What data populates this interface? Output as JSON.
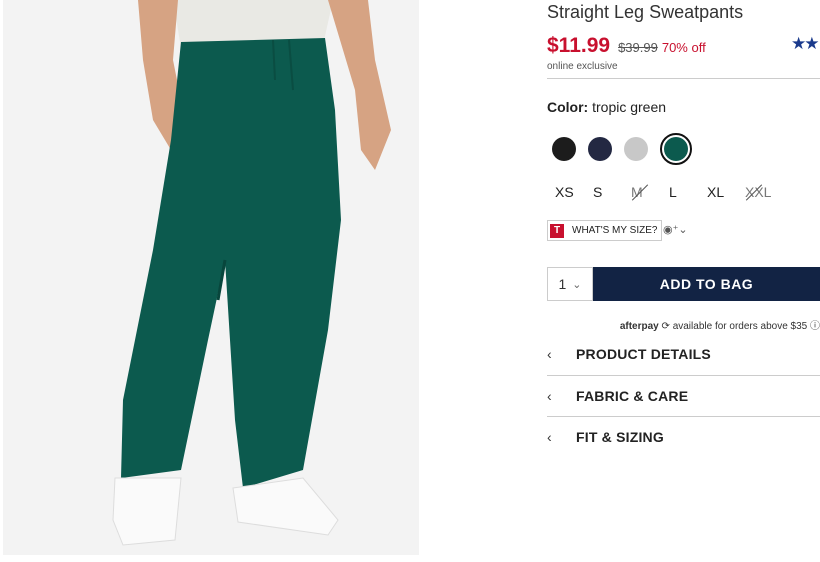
{
  "product": {
    "title": "Straight Leg Sweatpants",
    "sale_price": "$11.99",
    "original_price": "$39.99",
    "discount": "70% off",
    "badge": "online exclusive",
    "rating_stars": "★★",
    "image_alt": "green-sweatpants-photo"
  },
  "color": {
    "label": "Color:",
    "selected": "tropic green",
    "swatches": [
      {
        "name": "black",
        "hex": "#1c1c1c"
      },
      {
        "name": "navy",
        "hex": "#232842"
      },
      {
        "name": "light-gray",
        "hex": "#c8c8c8"
      },
      {
        "name": "tropic-green",
        "hex": "#0c5a4e",
        "selected": true
      }
    ]
  },
  "sizes": [
    {
      "label": "XS",
      "available": true
    },
    {
      "label": "S",
      "available": true
    },
    {
      "label": "M",
      "available": false
    },
    {
      "label": "L",
      "available": true
    },
    {
      "label": "XL",
      "available": true
    },
    {
      "label": "XXL",
      "available": false
    }
  ],
  "size_tool": {
    "logo": "T",
    "label": "WHAT'S MY SIZE?",
    "people_icon": "◉⁺⌄"
  },
  "cart": {
    "quantity": "1",
    "qty_chevron": "⌄",
    "add_label": "ADD TO BAG"
  },
  "afterpay": {
    "brand": "afterpay",
    "text": "available for orders above $35",
    "info_icon": "ⓘ"
  },
  "accordions": [
    {
      "label": "PRODUCT DETAILS"
    },
    {
      "label": "FABRIC & CARE"
    },
    {
      "label": "FIT & SIZING"
    }
  ],
  "colors": {
    "sale": "#c8102e",
    "button": "#122344",
    "pants": "#0c5a4e"
  }
}
